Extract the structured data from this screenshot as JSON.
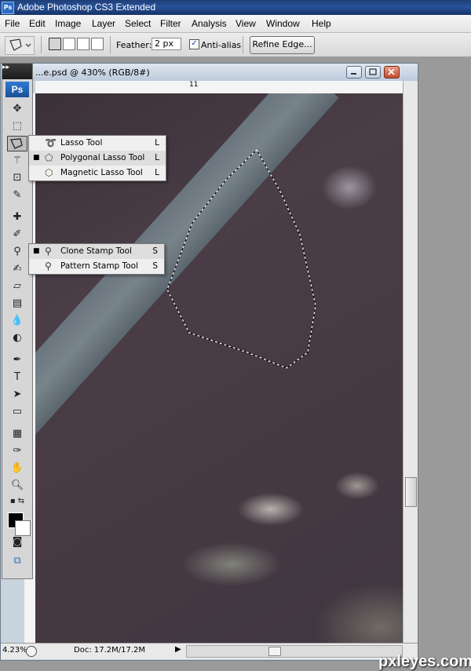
{
  "app": {
    "title": "Adobe Photoshop CS3 Extended",
    "logo": "Ps"
  },
  "menubar": {
    "items": [
      "File",
      "Edit",
      "Image",
      "Layer",
      "Select",
      "Filter",
      "Analysis",
      "View",
      "Window",
      "Help"
    ]
  },
  "options": {
    "feather_label": "Feather:",
    "feather_value": "2 px",
    "antialias_label": "Anti-alias",
    "antialias_checked": true,
    "refine_button": "Refine Edge..."
  },
  "document": {
    "title": "...e.psd @ 430% (RGB/8#)",
    "ruler_label": "11",
    "zoom": "4.23%",
    "doc_info": "Doc: 17.2M/17.2M"
  },
  "flyouts": {
    "lasso": [
      {
        "label": "Lasso Tool",
        "key": "L",
        "selected": false,
        "icon": "lasso-icon"
      },
      {
        "label": "Polygonal Lasso Tool",
        "key": "L",
        "selected": true,
        "icon": "polygonal-lasso-icon"
      },
      {
        "label": "Magnetic Lasso Tool",
        "key": "L",
        "selected": false,
        "icon": "magnetic-lasso-icon"
      }
    ],
    "stamp": [
      {
        "label": "Clone Stamp Tool",
        "key": "S",
        "selected": true,
        "icon": "clone-stamp-icon"
      },
      {
        "label": "Pattern Stamp Tool",
        "key": "S",
        "selected": false,
        "icon": "pattern-stamp-icon"
      }
    ]
  },
  "colors": {
    "foreground": "#000000",
    "background": "#ffffff"
  },
  "watermark": "pxleyes.com"
}
